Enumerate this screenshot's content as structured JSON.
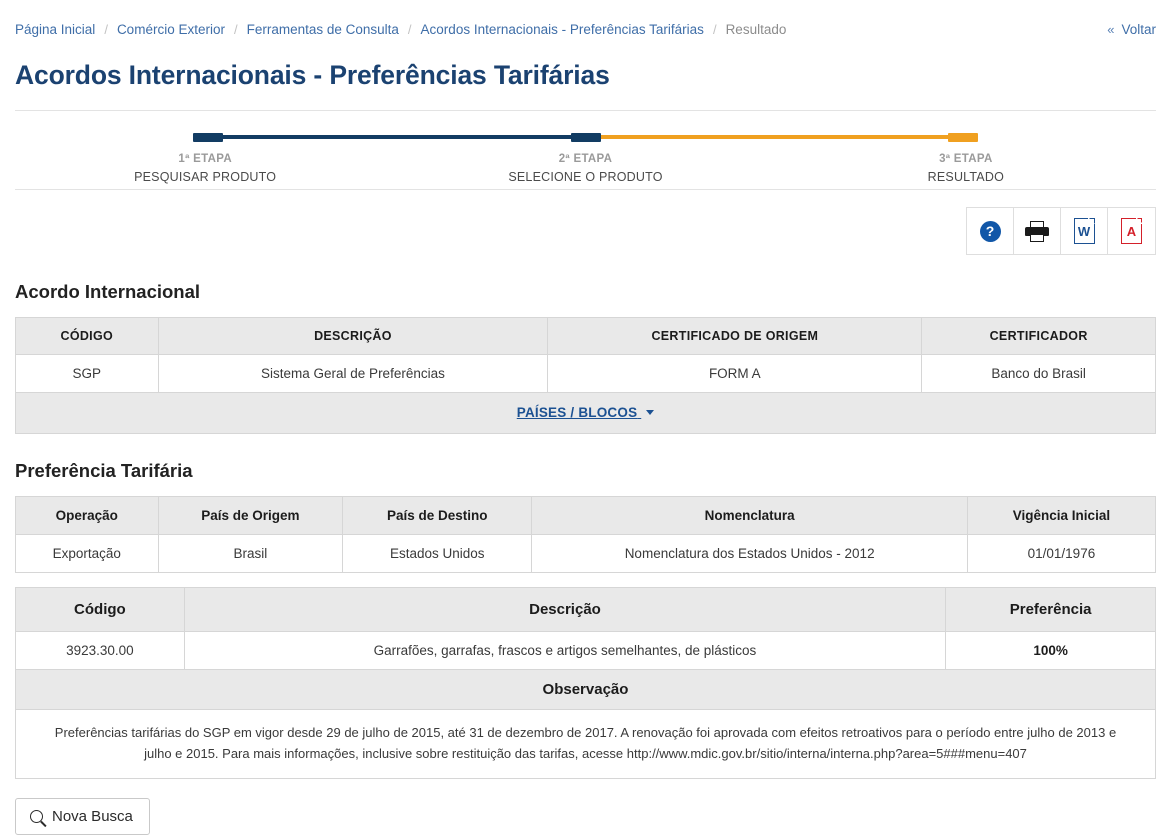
{
  "breadcrumb": {
    "items": [
      {
        "label": "Página Inicial",
        "current": false
      },
      {
        "label": "Comércio Exterior",
        "current": false
      },
      {
        "label": "Ferramentas de Consulta",
        "current": false
      },
      {
        "label": "Acordos Internacionais - Preferências Tarifárias",
        "current": false
      },
      {
        "label": "Resultado",
        "current": true
      }
    ],
    "separator": "/",
    "back": {
      "chevron": "«",
      "label": "Voltar"
    }
  },
  "page": {
    "title": "Acordos Internacionais - Preferências Tarifárias"
  },
  "stepper": {
    "steps": [
      {
        "num": "1ª ETAPA",
        "text": "PESQUISAR PRODUTO"
      },
      {
        "num": "2ª ETAPA",
        "text": "SELECIONE O PRODUTO"
      },
      {
        "num": "3ª ETAPA",
        "text": "RESULTADO"
      }
    ],
    "colors": {
      "done": "#123c63",
      "active": "#f0a020"
    }
  },
  "toolbar": {
    "buttons": [
      {
        "name": "help",
        "glyph": "?"
      },
      {
        "name": "print",
        "glyph": ""
      },
      {
        "name": "word",
        "glyph": "W"
      },
      {
        "name": "pdf",
        "glyph": "A"
      }
    ]
  },
  "acordo": {
    "title": "Acordo Internacional",
    "headers": [
      "CÓDIGO",
      "DESCRIÇÃO",
      "CERTIFICADO DE ORIGEM",
      "CERTIFICADOR"
    ],
    "row": [
      "SGP",
      "Sistema Geral de Preferências",
      "FORM A",
      "Banco do Brasil"
    ],
    "paises_link": "PAÍSES / BLOCOS"
  },
  "preferencia": {
    "title": "Preferência Tarifária",
    "headers": [
      "Operação",
      "País de Origem",
      "País de Destino",
      "Nomenclatura",
      "Vigência Inicial"
    ],
    "row": [
      "Exportação",
      "Brasil",
      "Estados Unidos",
      "Nomenclatura dos Estados Unidos - 2012",
      "01/01/1976"
    ]
  },
  "produto": {
    "headers": [
      "Código",
      "Descrição",
      "Preferência"
    ],
    "row": [
      "3923.30.00",
      "Garrafões, garrafas, frascos e artigos semelhantes, de plásticos",
      "100%"
    ],
    "observacao_label": "Observação",
    "observacao_text": "Preferências tarifárias do SGP em vigor desde 29 de julho de 2015, até 31 de dezembro de 2017. A renovação foi aprovada com efeitos retroativos para o período entre julho de 2013 e julho e 2015. Para mais informações, inclusive sobre restituição das tarifas, acesse http://www.mdic.gov.br/sitio/interna/interna.php?area=5###menu=407"
  },
  "footer": {
    "nova_busca": "Nova Busca"
  }
}
